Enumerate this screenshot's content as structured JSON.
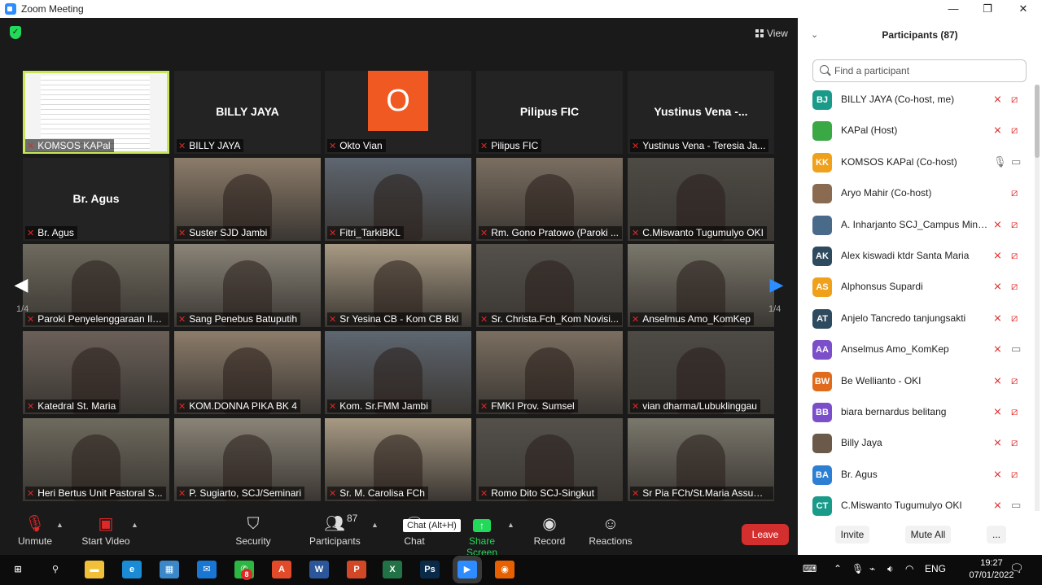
{
  "window": {
    "title": "Zoom Meeting",
    "minimize": "—",
    "restore": "❐",
    "close": "✕"
  },
  "meeting": {
    "view_label": "View",
    "page_left": "1/4",
    "page_right": "1/4"
  },
  "tiles": [
    {
      "label": "KOMSOS KAPal",
      "center": "",
      "type": "screen"
    },
    {
      "label": "BILLY JAYA",
      "center": "BILLY JAYA",
      "type": "name"
    },
    {
      "label": "Okto Vian",
      "center": "O",
      "type": "avatar"
    },
    {
      "label": "Pilipus FIC",
      "center": "Pilipus FIC",
      "type": "name"
    },
    {
      "label": "Yustinus Vena - Teresia Ja...",
      "center": "Yustinus Vena -...",
      "type": "name"
    },
    {
      "label": "Br. Agus",
      "center": "Br. Agus",
      "type": "name"
    },
    {
      "label": "Suster SJD Jambi",
      "center": "",
      "type": "video"
    },
    {
      "label": "Fitri_TarkiBKL",
      "center": "",
      "type": "video"
    },
    {
      "label": "Rm. Gono Pratowo (Paroki ...",
      "center": "",
      "type": "video"
    },
    {
      "label": "C.Miswanto Tugumulyo OKI",
      "center": "",
      "type": "video"
    },
    {
      "label": "Paroki Penyelenggaraan Ila...",
      "center": "",
      "type": "video"
    },
    {
      "label": "Sang Penebus Batuputih",
      "center": "",
      "type": "video"
    },
    {
      "label": "Sr Yesina CB - Kom CB Bkl",
      "center": "",
      "type": "video"
    },
    {
      "label": "Sr. Christa.Fch_Kom Novisi...",
      "center": "",
      "type": "video"
    },
    {
      "label": "Anselmus Amo_KomKep",
      "center": "",
      "type": "video"
    },
    {
      "label": "Katedral St. Maria",
      "center": "",
      "type": "video"
    },
    {
      "label": "KOM.DONNA PIKA BK 4",
      "center": "",
      "type": "video"
    },
    {
      "label": "Kom. Sr.FMM Jambi",
      "center": "",
      "type": "video"
    },
    {
      "label": "FMKI Prov. Sumsel",
      "center": "",
      "type": "video"
    },
    {
      "label": "vian dharma/Lubuklinggau",
      "center": "",
      "type": "video"
    },
    {
      "label": "Heri Bertus Unit Pastoral S...",
      "center": "",
      "type": "video"
    },
    {
      "label": "P. Sugiarto, SCJ/Seminari",
      "center": "",
      "type": "video"
    },
    {
      "label": "Sr. M. Carolisa FCh",
      "center": "",
      "type": "video"
    },
    {
      "label": "Romo Dito SCJ-Singkut",
      "center": "",
      "type": "video"
    },
    {
      "label": "Sr Pia FCh/St.Maria Assumt...",
      "center": "",
      "type": "video"
    }
  ],
  "toolbar": {
    "unmute": "Unmute",
    "start_video": "Start Video",
    "security": "Security",
    "participants": "Participants",
    "participants_count": "87",
    "chat": "Chat",
    "chat_tooltip": "Chat (Alt+H)",
    "share_screen": "Share Screen",
    "record": "Record",
    "reactions": "Reactions",
    "leave": "Leave"
  },
  "panel": {
    "title": "Participants (87)",
    "search_placeholder": "Find a participant",
    "participants": [
      {
        "initials": "BJ",
        "name": "BILLY JAYA (Co-host, me)",
        "color": "#1a9b8a",
        "mic_on": false
      },
      {
        "initials": "",
        "name": "KAPal (Host)",
        "color": "#3aa845",
        "mic_on": false
      },
      {
        "initials": "KK",
        "name": "KOMSOS KAPal (Co-host)",
        "color": "#f0a11c",
        "mic_on": true
      },
      {
        "initials": "",
        "name": "Aryo Mahir (Co-host)",
        "color": "#8a6b52",
        "mic_on": null
      },
      {
        "initials": "",
        "name": "A. Inharjanto SCJ_Campus Minis...",
        "color": "#4a6a8a",
        "mic_on": false
      },
      {
        "initials": "AK",
        "name": "Alex kiswadi ktdr Santa Maria",
        "color": "#2e4a5e",
        "mic_on": false
      },
      {
        "initials": "AS",
        "name": "Alphonsus Supardi",
        "color": "#f0a11c",
        "mic_on": false
      },
      {
        "initials": "AT",
        "name": "Anjelo Tancredo tanjungsakti",
        "color": "#2e4a5e",
        "mic_on": false
      },
      {
        "initials": "AA",
        "name": "Anselmus Amo_KomKep",
        "color": "#7b4fc9",
        "mic_on": false
      },
      {
        "initials": "BW",
        "name": "Be Wellianto - OKI",
        "color": "#e06b1c",
        "mic_on": false
      },
      {
        "initials": "BB",
        "name": "biara bernardus belitang",
        "color": "#7b4fc9",
        "mic_on": false
      },
      {
        "initials": "",
        "name": "Billy Jaya",
        "color": "#6b5a4a",
        "mic_on": false
      },
      {
        "initials": "BA",
        "name": "Br. Agus",
        "color": "#2d7fd3",
        "mic_on": false
      },
      {
        "initials": "CT",
        "name": "C.Miswanto Tugumulyo OKI",
        "color": "#1a9b8a",
        "mic_on": false
      }
    ],
    "invite": "Invite",
    "mute_all": "Mute All",
    "more": "..."
  },
  "taskbar": {
    "lang": "ENG",
    "time": "19:27",
    "date": "07/01/2022",
    "whatsapp_badge": "8",
    "apps": [
      {
        "icon": "windows-start-icon",
        "label": "⊞",
        "color": "#0c0c0c"
      },
      {
        "icon": "search-icon",
        "label": "⚲",
        "color": "#0c0c0c"
      },
      {
        "icon": "file-explorer-icon",
        "label": "▬",
        "color": "#f2c038"
      },
      {
        "icon": "edge-icon",
        "label": "e",
        "color": "#1b8bd6"
      },
      {
        "icon": "photos-icon",
        "label": "▦",
        "color": "#3a87c9"
      },
      {
        "icon": "mail-icon",
        "label": "✉",
        "color": "#1976d2"
      },
      {
        "icon": "whatsapp-icon",
        "label": "✆",
        "color": "#2bb741"
      },
      {
        "icon": "acrobat-icon",
        "label": "A",
        "color": "#e14b2a"
      },
      {
        "icon": "word-icon",
        "label": "W",
        "color": "#2b579a"
      },
      {
        "icon": "powerpoint-icon",
        "label": "P",
        "color": "#d24726"
      },
      {
        "icon": "excel-icon",
        "label": "X",
        "color": "#217346"
      },
      {
        "icon": "photoshop-icon",
        "label": "Ps",
        "color": "#0a2a4a"
      },
      {
        "icon": "zoom-icon",
        "label": "▶",
        "color": "#2d8cff"
      },
      {
        "icon": "firefox-icon",
        "label": "◉",
        "color": "#e66000"
      }
    ]
  }
}
